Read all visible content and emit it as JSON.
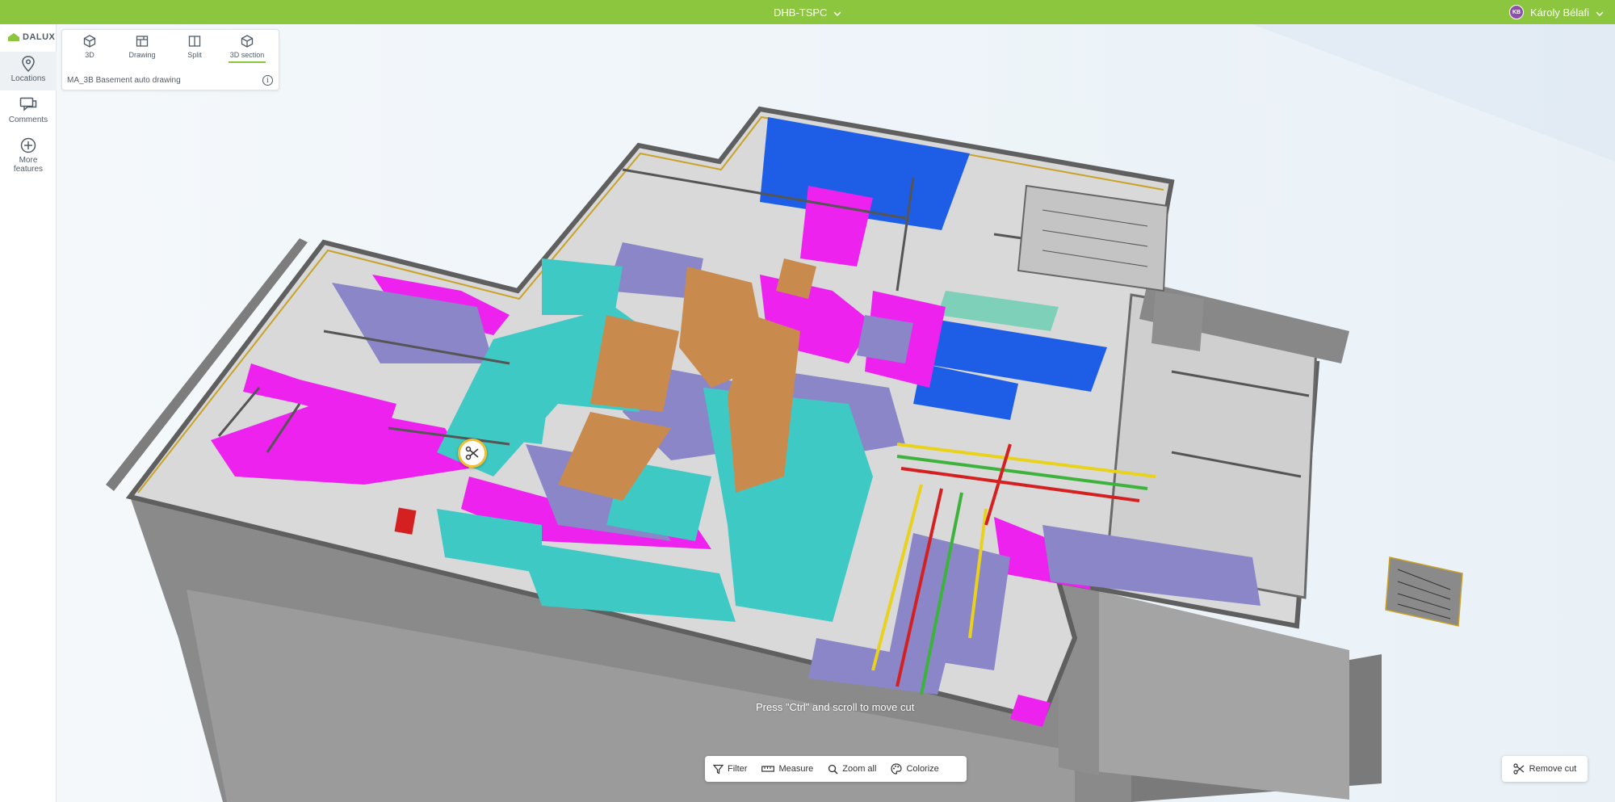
{
  "topbar": {
    "project": "DHB-TSPC",
    "user_name": "Károly Bélafi",
    "user_initials": "KB",
    "accent": "#8cc63f"
  },
  "sidebar": {
    "logo": "DALUX",
    "items": [
      {
        "label": "Locations",
        "icon": "map-pin-icon",
        "active": true
      },
      {
        "label": "Comments",
        "icon": "comment-icon",
        "active": false
      },
      {
        "label": "More features",
        "icon": "plus-circle-icon",
        "active": false
      }
    ]
  },
  "view_modes": {
    "tabs": [
      {
        "label": "3D",
        "icon": "cube-icon"
      },
      {
        "label": "Drawing",
        "icon": "drawing-icon"
      },
      {
        "label": "Split",
        "icon": "split-icon"
      },
      {
        "label": "3D section",
        "icon": "section-cube-icon",
        "active": true
      }
    ],
    "location": "MA_3B Basement auto drawing"
  },
  "viewport": {
    "hint": "Press \"Ctrl\" and scroll to move cut",
    "colors": {
      "wall_grey": "#7d7d7d",
      "duct_cyan": "#3fc9c4",
      "duct_magenta": "#ee22ee",
      "duct_purple": "#8a86c8",
      "duct_brown": "#c98a4e",
      "room_blue": "#1e5ee6",
      "pipe_yellow": "#e8d21c",
      "pipe_red": "#d42020",
      "pipe_green": "#3db33d"
    }
  },
  "toolbar": {
    "filter": "Filter",
    "measure": "Measure",
    "zoom_all": "Zoom all",
    "colorize": "Colorize"
  },
  "remove_cut": "Remove cut"
}
